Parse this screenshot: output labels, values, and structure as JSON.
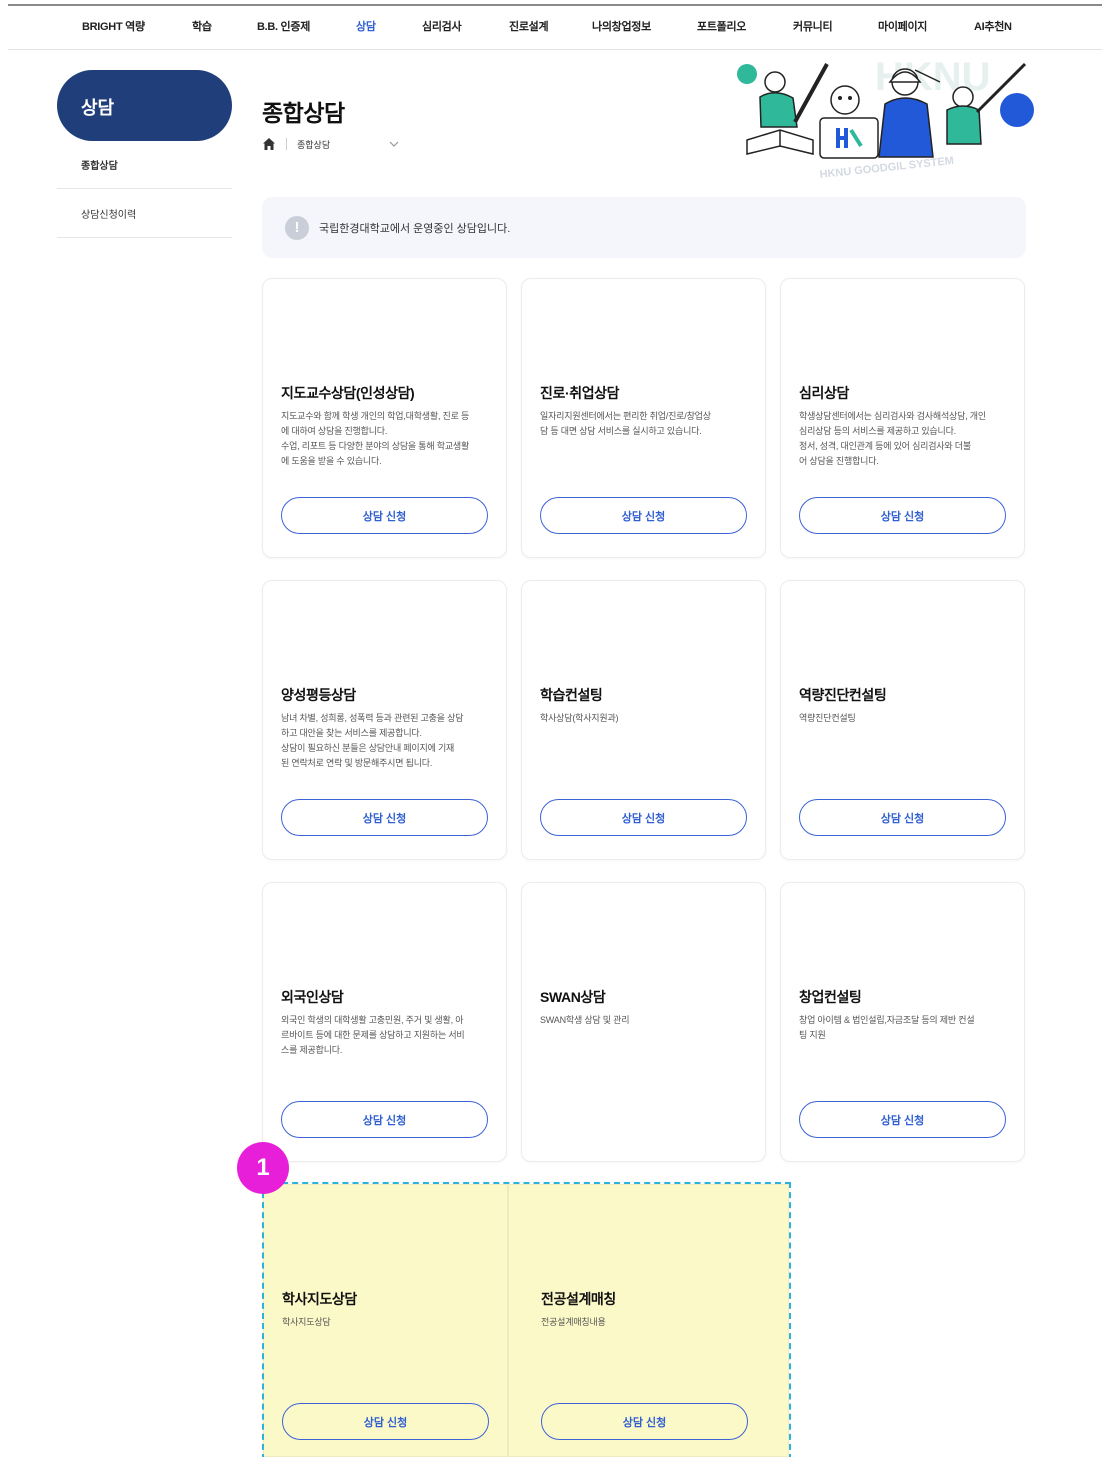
{
  "nav": {
    "items": [
      "BRIGHT 역량",
      "학습",
      "B.B. 인증제",
      "상담",
      "심리검사",
      "진로설계",
      "나의창업정보",
      "포트폴리오",
      "커뮤니티",
      "마이페이지",
      "AI추천N"
    ],
    "active_index": 3
  },
  "sidebar": {
    "title": "상담",
    "items": [
      {
        "label": "종합상담",
        "active": true
      },
      {
        "label": "상담신청이력",
        "active": false
      }
    ]
  },
  "page": {
    "title": "종합상담",
    "breadcrumb": "종합상담",
    "hero_text": "HKNU GOODGIL SYSTEM"
  },
  "notice": {
    "text": "국립한경대학교에서 운영중인 상담입니다."
  },
  "cards": [
    {
      "title": "지도교수상담(인성상담)",
      "description": "지도교수와 함께 학생 개인의 학업,대학생활, 진로 등\n에 대하여 상담을 진행합니다.\n수업, 리포트 등 다양한 분야의 상담을 통해 학교생활\n에 도움을 받을 수 있습니다.",
      "button": "상담 신청"
    },
    {
      "title": "진로·취업상담",
      "description": "일자리지원센터에서는 편리한 취업/진로/창업상\n담 등 대면 상담 서비스를 실시하고 있습니다.",
      "button": "상담 신청"
    },
    {
      "title": "심리상담",
      "description": "학생상담센터에서는 심리검사와 검사해석상담, 개인\n심리상담 등의 서비스를 제공하고 있습니다.\n정서, 성격, 대인관계 등에 있어 심리검사와 더불\n어 상담을 진행합니다.",
      "button": "상담 신청"
    },
    {
      "title": "양성평등상담",
      "description": "남녀 차별, 성희롱, 성폭력 등과 관련된 고충을 상담\n하고 대안을 찾는 서비스를 제공합니다.\n상담이 필요하신 분들은 상담안내 페이지에 기재\n된 연락처로 연락 및 방문해주시면 됩니다.",
      "button": "상담 신청"
    },
    {
      "title": "학습컨설팅",
      "description": "학사상담(학사지원과)",
      "button": "상담 신청"
    },
    {
      "title": "역량진단컨설팅",
      "description": "역량진단컨설팅",
      "button": "상담 신청"
    },
    {
      "title": "외국인상담",
      "description": "외국인 학생의 대학생활 고충민원, 주거 및 생활, 아\n르바이트 등에 대한 문제를 상담하고 지원하는 서비\n스를 제공합니다.",
      "button": "상담 신청"
    },
    {
      "title": "SWAN상담",
      "description": "SWAN학생 상담 및 관리",
      "button": ""
    },
    {
      "title": "창업컨설팅",
      "description": "창업 아이템 & 법인설립,자금조달 등의 제반 컨설\n팅 지원",
      "button": "상담 신청"
    },
    {
      "title": "학사지도상담",
      "description": "학사지도상담",
      "button": "상담 신청"
    },
    {
      "title": "전공설계매칭",
      "description": "전공설계매칭내용",
      "button": "상담 신청"
    }
  ],
  "annotation": {
    "marker": "1",
    "highlight_color": "#fcf9c9",
    "dash_color": "#2bb3dd",
    "marker_color": "#e81fd9"
  },
  "colors": {
    "brand_navy": "#1f3e7a",
    "accent_blue": "#2f5fd0",
    "hero_teal": "#2fb89a",
    "hero_blue": "#2159d9"
  }
}
